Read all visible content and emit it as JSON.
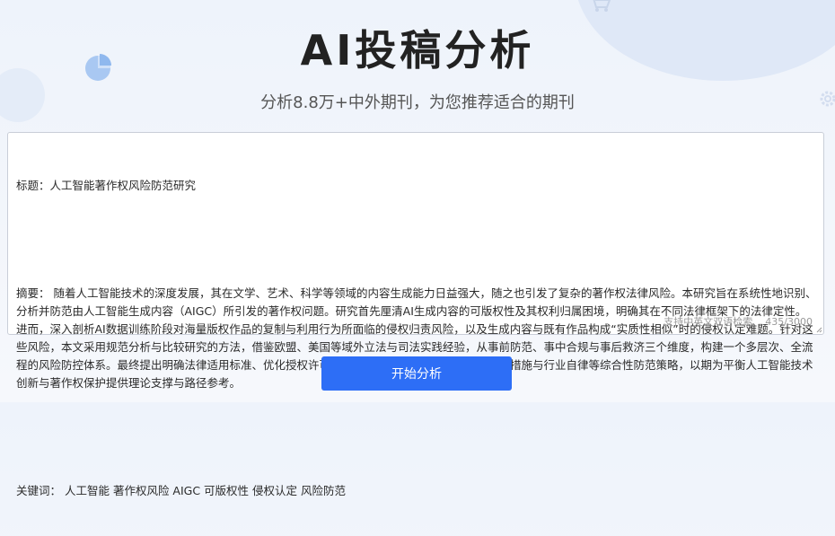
{
  "header": {
    "title": "AI投稿分析",
    "subtitle": "分析8.8万+中外期刊，为您推荐适合的期刊"
  },
  "editor": {
    "title_line": "标题：人工智能著作权风险防范研究",
    "abstract_line": "摘要： 随着人工智能技术的深度发展，其在文学、艺术、科学等领域的内容生成能力日益强大，随之也引发了复杂的著作权法律风险。本研究旨在系统性地识别、分析并防范由人工智能生成内容（AIGC）所引发的著作权问题。研究首先厘清AI生成内容的可版权性及其权利归属困境，明确其在不同法律框架下的法律定性。进而，深入剖析AI数据训练阶段对海量版权作品的复制与利用行为所面临的侵权归责风险，以及生成内容与既有作品构成“实质性相似”时的侵权认定难题。针对这些风险，本文采用规范分析与比较研究的方法，借鉴欧盟、美国等域外立法与司法实践经验，从事前防范、事中合规与事后救济三个维度，构建一个多层次、全流程的风险防控体系。最终提出明确法律适用标准、优化授权许可机制、引入版权例外规则、强化技术措施与行业自律等综合性防范策略，以期为平衡人工智能技术创新与著作权保护提供理论支撑与路径参考。",
    "keywords_line": "关键词： 人工智能 著作权风险 AIGC 可版权性 侵权认定 风险防范",
    "hint": "支持中英文双语检索",
    "counter": "435/3000"
  },
  "actions": {
    "start_label": "开始分析"
  },
  "colors": {
    "accent": "#2d6ef6",
    "background": "#eef3fb"
  }
}
